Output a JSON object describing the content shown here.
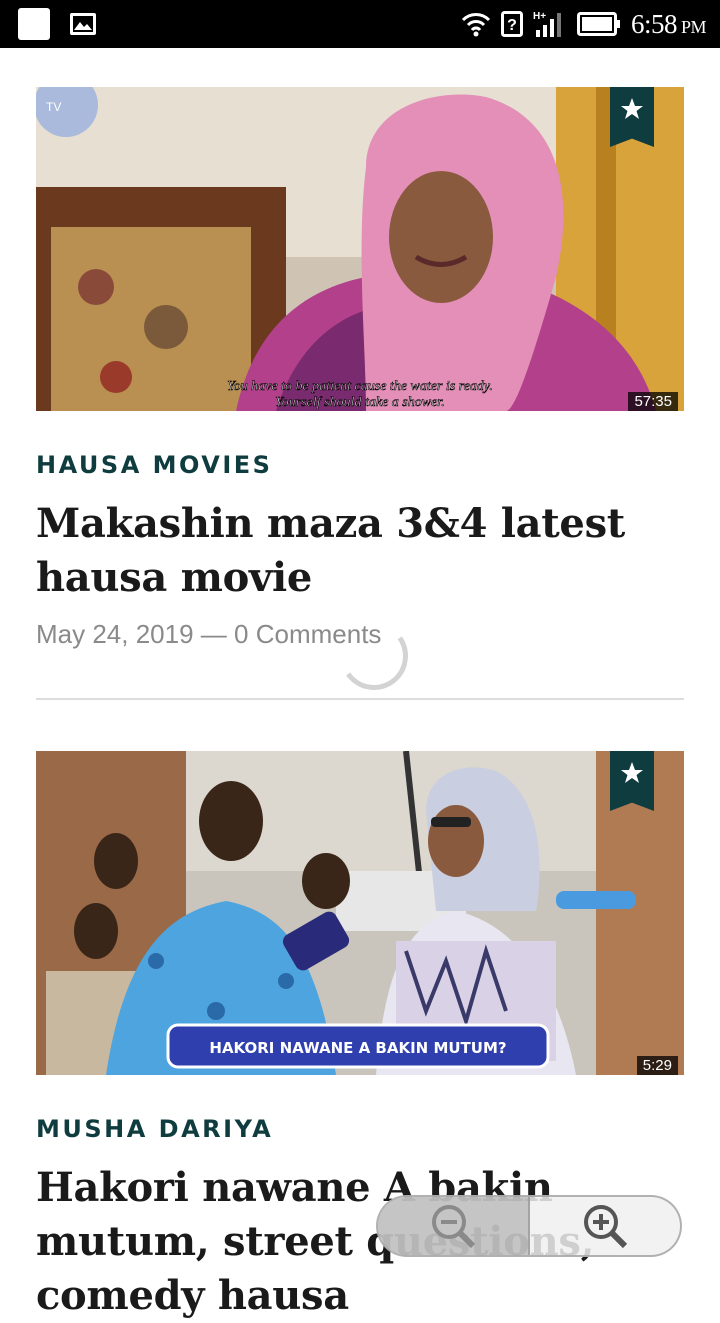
{
  "status_bar": {
    "time": "6:58",
    "ampm": "PM",
    "network": "H+"
  },
  "articles": [
    {
      "category": "HAUSA MOVIES",
      "title": "Makashin maza 3&4 latest hausa movie",
      "date": "May 24, 2019",
      "separator": "—",
      "comments": "0 Comments",
      "thumbnail": {
        "subtitle_line1": "You have to be patient cause the water is ready.",
        "subtitle_line2": "Yourself should take a shower.",
        "duration": "57:35"
      }
    },
    {
      "category": "MUSHA DARIYA",
      "title": "Hakori nawane A bakin mutum, street questions,",
      "title_cut": "comedy hausa",
      "thumbnail": {
        "banner": "HAKORI NAWANE A BAKIN MUTUM?",
        "duration": "5:29"
      }
    }
  ],
  "icons": {
    "bookmark": "star-bookmark-icon",
    "zoom_out": "zoom-out-icon",
    "zoom_in": "zoom-in-icon",
    "wifi": "wifi-icon",
    "battery": "battery-icon"
  },
  "colors": {
    "accent": "#0f3c3f",
    "title": "#1a1a1a",
    "meta": "#8a8a8a"
  }
}
